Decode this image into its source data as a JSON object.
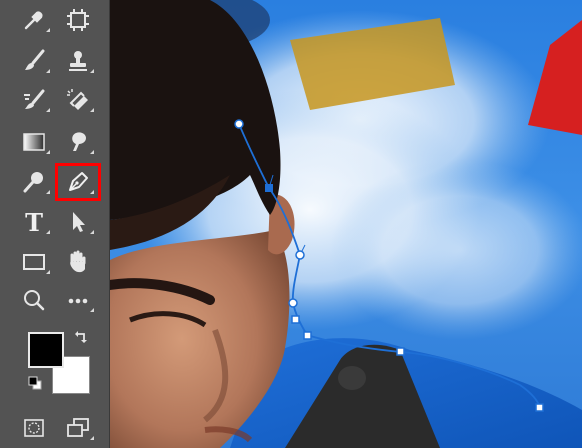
{
  "app": "Photoshop",
  "toolbar": {
    "tools": [
      {
        "name": "eyedropper-tool",
        "icon": "eyedropper-icon"
      },
      {
        "name": "artboard-crop-tool",
        "icon": "crop-frame-icon"
      },
      {
        "name": "brush-tool",
        "icon": "brush-icon"
      },
      {
        "name": "clone-stamp-tool",
        "icon": "stamp-icon"
      },
      {
        "name": "history-brush-tool",
        "icon": "history-brush-icon"
      },
      {
        "name": "eraser-tool",
        "icon": "eraser-icon"
      },
      {
        "name": "gradient-tool",
        "icon": "gradient-icon"
      },
      {
        "name": "blur-tool",
        "icon": "smudge-icon"
      },
      {
        "name": "dodge-tool",
        "icon": "dodge-icon"
      },
      {
        "name": "pen-tool",
        "icon": "pen-icon",
        "selected": true
      },
      {
        "name": "type-tool",
        "icon": "type-icon",
        "label": "T"
      },
      {
        "name": "path-selection-tool",
        "icon": "arrow-icon"
      },
      {
        "name": "rectangle-tool",
        "icon": "rectangle-icon"
      },
      {
        "name": "hand-tool",
        "icon": "hand-icon"
      },
      {
        "name": "zoom-tool",
        "icon": "magnifier-icon"
      },
      {
        "name": "more-tools",
        "icon": "ellipsis-icon"
      },
      {
        "name": "quick-mask-mode",
        "icon": "quick-mask-icon"
      },
      {
        "name": "screen-mode",
        "icon": "screen-mode-icon"
      }
    ],
    "foreground_color": "#000000",
    "background_color": "#ffffff",
    "highlight_color": "#ff0000"
  },
  "canvas": {
    "path_color": "#1e6fd6",
    "sky_color": "#2f86e0"
  }
}
